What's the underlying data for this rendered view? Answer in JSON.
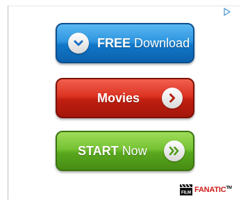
{
  "buttons": {
    "download": {
      "strong": "FREE",
      "thin": "Download"
    },
    "movies": {
      "strong": "Movies"
    },
    "start": {
      "strong": "START",
      "thin": "Now"
    }
  },
  "logo": {
    "film": "FILM",
    "fanatic": "FANATIC",
    "tm": "TM"
  },
  "colors": {
    "download_button": "#1b84d3",
    "movies_button": "#c8281a",
    "start_button": "#6ab62a"
  }
}
